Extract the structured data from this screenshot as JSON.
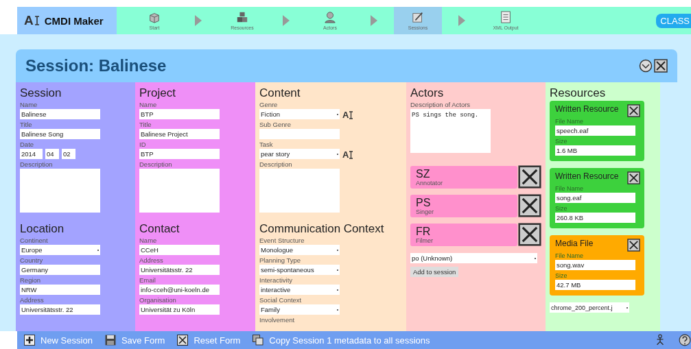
{
  "app": {
    "logo_mark": "A",
    "title": "CMDI Maker",
    "badge": "CLASS"
  },
  "steps": [
    {
      "label": "Start",
      "selected": false
    },
    {
      "label": "Resources",
      "selected": false
    },
    {
      "label": "Actors",
      "selected": false
    },
    {
      "label": "Sessions",
      "selected": true
    },
    {
      "label": "XML Output",
      "selected": false
    }
  ],
  "panel": {
    "title": "Session: Balinese"
  },
  "columns": [
    {
      "kind": "form",
      "color": "#a3a3ff",
      "sections": [
        {
          "heading": "Session",
          "fields": [
            {
              "label": "Name",
              "kind": "text",
              "value": "Balinese"
            },
            {
              "label": "Title",
              "kind": "text",
              "value": "Balinese Song"
            },
            {
              "label": "Date",
              "kind": "date",
              "parts": [
                "2014",
                "04",
                "02"
              ]
            },
            {
              "label": "Description",
              "kind": "textarea"
            }
          ]
        },
        {
          "heading": "Location",
          "fields": [
            {
              "label": "Continent",
              "kind": "select",
              "value": "Europe"
            },
            {
              "label": "Country",
              "kind": "text",
              "value": "Germany"
            },
            {
              "label": "Region",
              "kind": "text",
              "value": "NRW"
            },
            {
              "label": "Address",
              "kind": "text",
              "value": "Universitätsstr. 22"
            }
          ]
        }
      ]
    },
    {
      "kind": "form",
      "color": "#ef8ff7",
      "sections": [
        {
          "heading": "Project",
          "fields": [
            {
              "label": "Name",
              "kind": "text",
              "value": "BTP"
            },
            {
              "label": "Title",
              "kind": "text",
              "value": "Balinese Project"
            },
            {
              "label": "ID",
              "kind": "text",
              "value": "BTP"
            },
            {
              "label": "Description",
              "kind": "textarea"
            }
          ]
        },
        {
          "heading": "Contact",
          "fields": [
            {
              "label": "Name",
              "kind": "text",
              "value": "CCeH"
            },
            {
              "label": "Address",
              "kind": "text",
              "value": "Universitätsstr. 22"
            },
            {
              "label": "Email",
              "kind": "text",
              "value": "info-cceh@uni-koeln.de"
            },
            {
              "label": "Organisation",
              "kind": "text",
              "value": "Universität zu Köln"
            }
          ]
        }
      ]
    },
    {
      "kind": "form",
      "color": "#ffe5c9",
      "sections": [
        {
          "heading": "Content",
          "fields": [
            {
              "label": "Genre",
              "kind": "select",
              "value": "Fiction",
              "vocab": "A"
            },
            {
              "label": "Sub Genre",
              "kind": "text"
            },
            {
              "label": "Task",
              "kind": "select",
              "value": "pear story",
              "vocab": "A"
            },
            {
              "label": "Description",
              "kind": "textarea"
            }
          ]
        },
        {
          "heading": "Communication Context",
          "fields": [
            {
              "label": "Event Structure",
              "kind": "select",
              "value": "Monologue"
            },
            {
              "label": "Planning Type",
              "kind": "select",
              "value": "semi-spontaneous"
            },
            {
              "label": "Interactivity",
              "kind": "select",
              "value": "interactive"
            },
            {
              "label": "Social Context",
              "kind": "select",
              "value": "Family"
            },
            {
              "label": "Involvement",
              "kind": "label"
            }
          ]
        }
      ]
    },
    {
      "kind": "actors",
      "color": "#ffcccc",
      "heading": "Actors",
      "description_label": "Description of Actors",
      "description": "PS sings the song.",
      "actors": [
        {
          "code": "SZ",
          "role": "Annotator"
        },
        {
          "code": "PS",
          "role": "Singer"
        },
        {
          "code": "FR",
          "role": "Filmer"
        }
      ],
      "picker": "po (Unknown)",
      "add_button": "Add to session"
    },
    {
      "kind": "resources",
      "color": "#ccffcc",
      "heading": "Resources",
      "resources": [
        {
          "kind": "written",
          "title": "Written Resource",
          "file_label": "File Name",
          "file": "speech.eaf",
          "size_label": "Size",
          "size": "1.6 MB"
        },
        {
          "kind": "written",
          "title": "Written Resource",
          "file_label": "File Name",
          "file": "song.eaf",
          "size_label": "Size",
          "size": "260.8 KB"
        },
        {
          "kind": "media",
          "title": "Media File",
          "file_label": "File Name",
          "file": "song.wav",
          "size_label": "Size",
          "size": "42.7 MB"
        }
      ],
      "picker": "chrome_200_percent.j"
    }
  ],
  "actions": [
    {
      "kind": "new",
      "label": "New Session"
    },
    {
      "kind": "save",
      "label": "Save Form"
    },
    {
      "kind": "reset",
      "label": "Reset Form"
    },
    {
      "kind": "copy",
      "label": "Copy Session 1 metadata to all sessions"
    }
  ]
}
